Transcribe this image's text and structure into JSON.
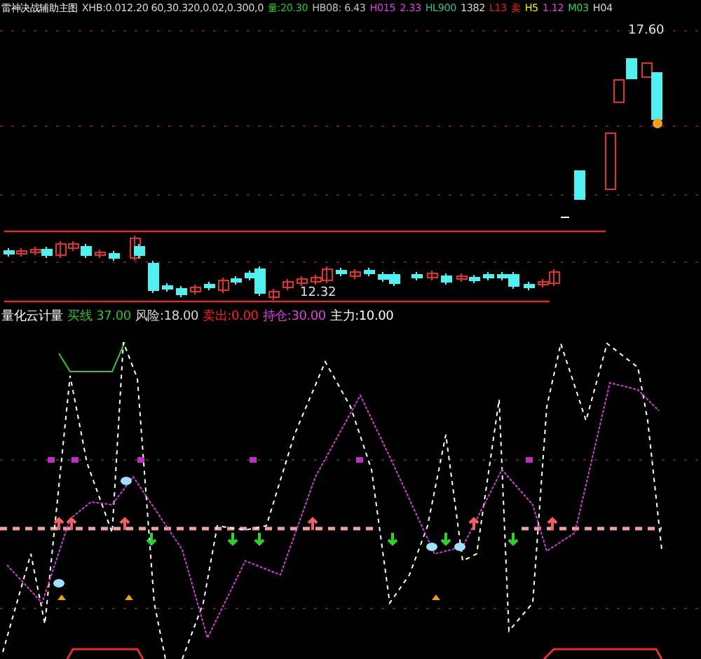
{
  "main_header": {
    "title": "雷神决战辅助主图",
    "items": [
      {
        "text": "XHB:0.012.20 60,30.320,0.02,0.300,0",
        "color": "#d8d8d8"
      },
      {
        "text": "量:20.30",
        "color": "#30c030"
      },
      {
        "text": "HB08: 6.43",
        "color": "#c0c0c0"
      },
      {
        "text": "H015",
        "color": "#e040e0"
      },
      {
        "text": "2.33",
        "color": "#e040e0"
      },
      {
        "text": "HL900",
        "color": "#30c090"
      },
      {
        "text": "1382",
        "color": "#d8d8d8"
      },
      {
        "text": "L13",
        "color": "#e02020"
      },
      {
        "text": "卖",
        "color": "#ff2020"
      },
      {
        "text": "H5",
        "color": "#f0f000"
      },
      {
        "text": "1.12",
        "color": "#e040e0"
      },
      {
        "text": "M03",
        "color": "#40d040"
      },
      {
        "text": "H04",
        "color": "#d8d8d8"
      }
    ]
  },
  "price_labels": [
    {
      "text": "17.60"
    },
    {
      "text": "12.32"
    }
  ],
  "indicator_header": {
    "title": "量化云计量",
    "items": [
      {
        "text": "买线",
        "color": "#30c030"
      },
      {
        "text": "37.00",
        "color": "#30c030"
      },
      {
        "text": "风险:18.00",
        "color": "#d8d8d8"
      },
      {
        "text": "卖出:0.00",
        "color": "#ff2020"
      },
      {
        "text": "持仓:30.00",
        "color": "#e040e0"
      },
      {
        "text": "主力:10.00",
        "color": "#ffffff"
      }
    ]
  }
}
